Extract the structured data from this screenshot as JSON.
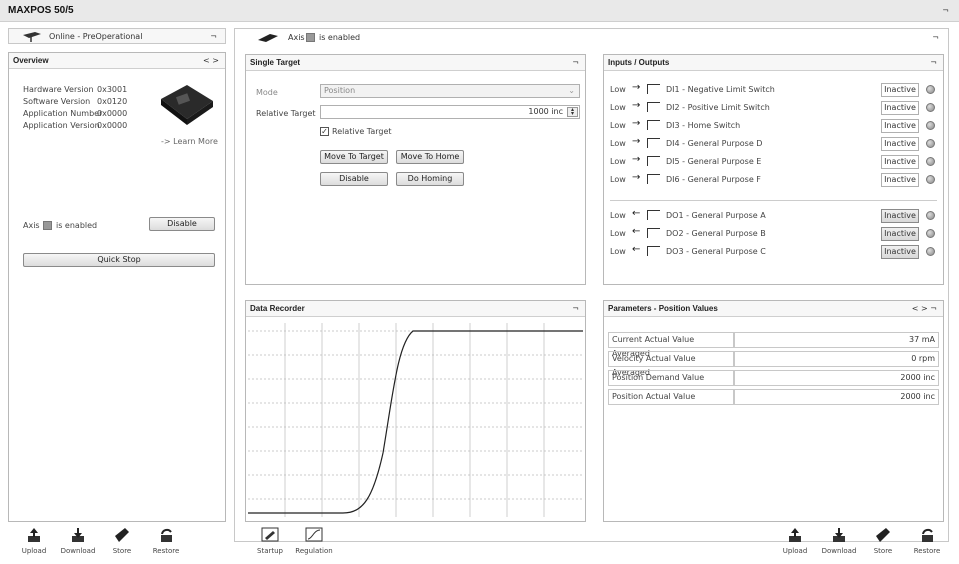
{
  "window": {
    "title": "MAXPOS 50/5",
    "corner": "¬"
  },
  "status": {
    "state_text": "Online  -  PreOperational",
    "corner": "¬"
  },
  "overview": {
    "title": "Overview",
    "nav": "< >",
    "rows": [
      {
        "label": "Hardware Version",
        "value": "0x3001"
      },
      {
        "label": "Software Version",
        "value": "0x0120"
      },
      {
        "label": "Application Number",
        "value": "0x0000"
      },
      {
        "label": "Application Version",
        "value": "0x0000"
      }
    ],
    "learn_more": "-> Learn More",
    "axis_label": "Axis",
    "axis_state": "is enabled",
    "disable_button": "Disable",
    "quick_stop_button": "Quick Stop"
  },
  "axis_header": {
    "axis_label": "Axis",
    "axis_state": "is enabled",
    "corner": "¬"
  },
  "single_target": {
    "title": "Single Target",
    "corner": "¬",
    "mode_label": "Mode",
    "mode_value": "Position",
    "relative_target_label": "Relative Target",
    "relative_target_value": "1000 inc",
    "relative_checkbox_label": "Relative Target",
    "relative_checked": true,
    "buttons": {
      "move_to_target": "Move To Target",
      "move_to_home": "Move To Home",
      "disable": "Disable",
      "do_homing": "Do Homing"
    }
  },
  "io": {
    "title": "Inputs / Outputs",
    "corner": "¬",
    "inputs": [
      {
        "level": "Low",
        "arrow": "→",
        "name": "DI1  -  Negative Limit Switch",
        "state": "Inactive"
      },
      {
        "level": "Low",
        "arrow": "→",
        "name": "DI2  -  Positive Limit Switch",
        "state": "Inactive"
      },
      {
        "level": "Low",
        "arrow": "→",
        "name": "DI3  -  Home Switch",
        "state": "Inactive"
      },
      {
        "level": "Low",
        "arrow": "→",
        "name": "DI4  -  General Purpose D",
        "state": "Inactive"
      },
      {
        "level": "Low",
        "arrow": "→",
        "name": "DI5  -  General Purpose E",
        "state": "Inactive"
      },
      {
        "level": "Low",
        "arrow": "→",
        "name": "DI6  -  General Purpose F",
        "state": "Inactive"
      }
    ],
    "outputs": [
      {
        "level": "Low",
        "arrow": "←",
        "name": "DO1  -  General Purpose A",
        "state": "Inactive"
      },
      {
        "level": "Low",
        "arrow": "←",
        "name": "DO2  -  General Purpose B",
        "state": "Inactive"
      },
      {
        "level": "Low",
        "arrow": "←",
        "name": "DO3  -  General Purpose C",
        "state": "Inactive"
      }
    ]
  },
  "recorder": {
    "title": "Data Recorder",
    "corner": "¬"
  },
  "params": {
    "title": "Parameters - Position Values",
    "nav": "< >  ¬",
    "rows": [
      {
        "label": "Current Actual Value Averaged",
        "value": "37 mA"
      },
      {
        "label": "Velocity Actual Value Averaged",
        "value": "0 rpm"
      },
      {
        "label": "Position Demand Value",
        "value": "2000 inc"
      },
      {
        "label": "Position Actual Value",
        "value": "2000 inc"
      }
    ]
  },
  "toolbar_left": {
    "upload": "Upload",
    "download": "Download",
    "store": "Store",
    "restore": "Restore"
  },
  "toolbar_mid": {
    "startup": "Startup",
    "regulation": "Regulation"
  },
  "toolbar_right": {
    "upload": "Upload",
    "download": "Download",
    "store": "Store",
    "restore": "Restore"
  }
}
